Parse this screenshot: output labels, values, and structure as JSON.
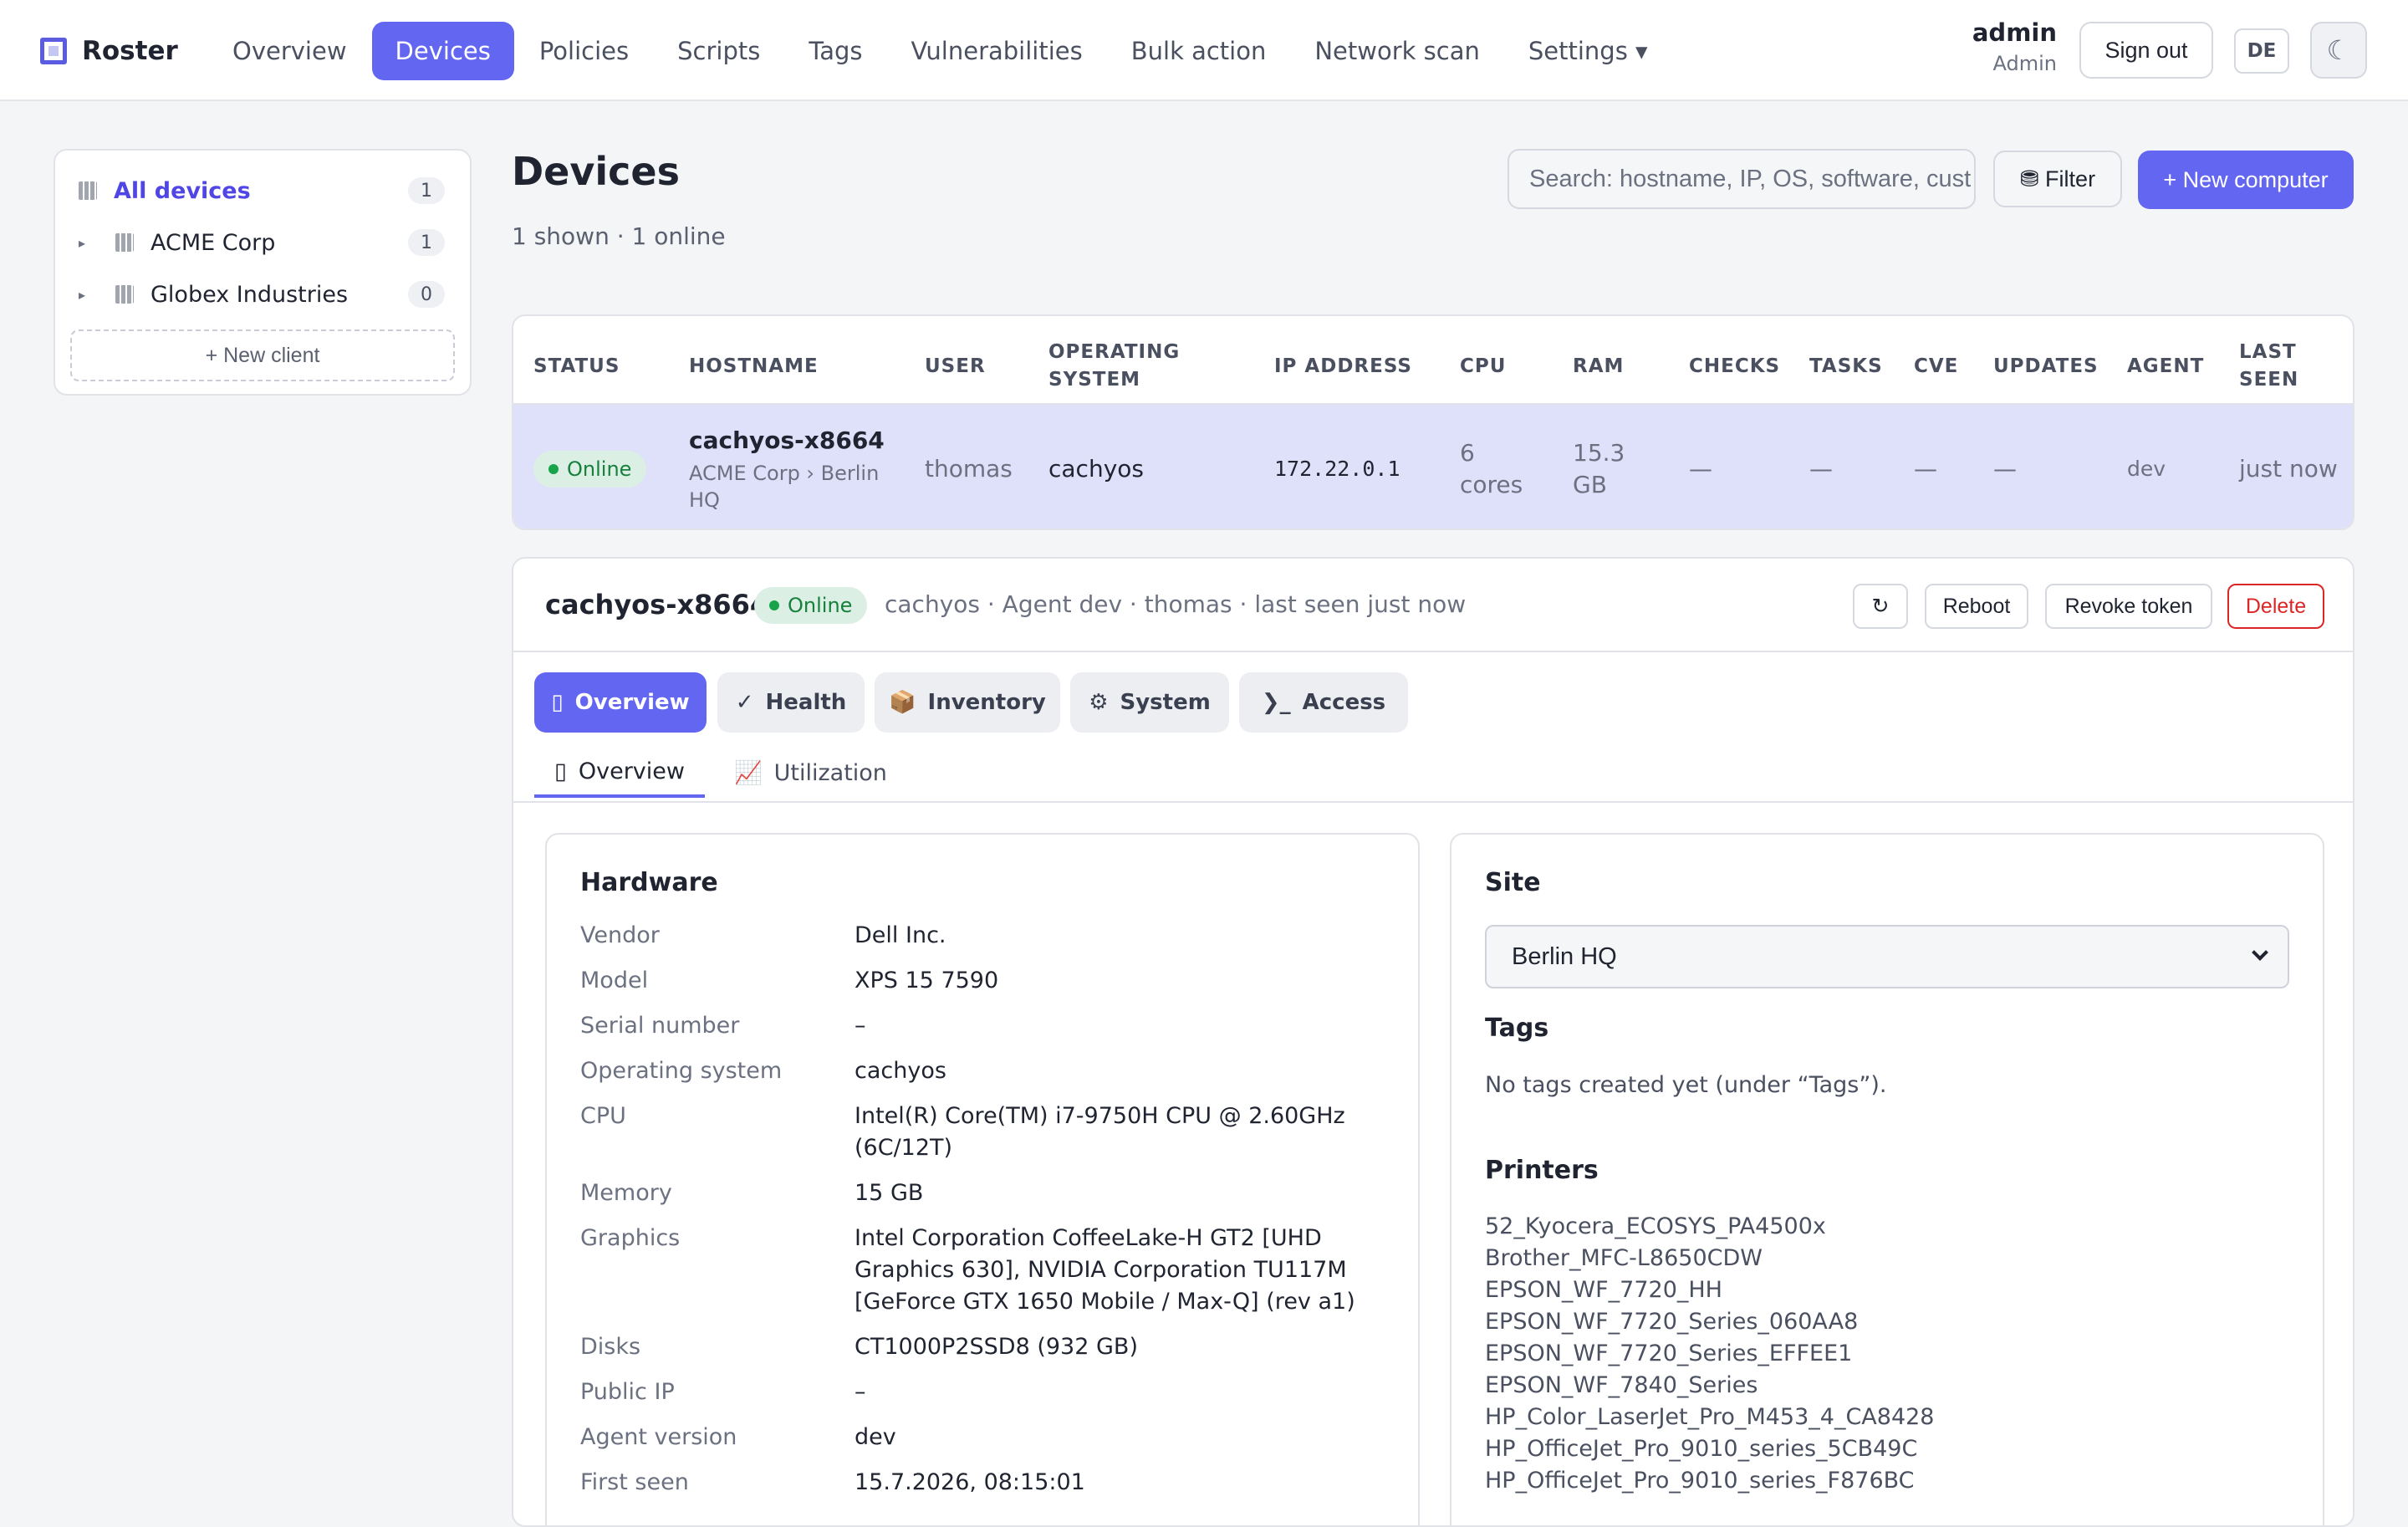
{
  "app": {
    "name": "Roster"
  },
  "nav": {
    "items": [
      {
        "label": "Overview"
      },
      {
        "label": "Devices"
      },
      {
        "label": "Policies"
      },
      {
        "label": "Scripts"
      },
      {
        "label": "Tags"
      },
      {
        "label": "Vulnerabilities"
      },
      {
        "label": "Bulk action"
      },
      {
        "label": "Network scan"
      },
      {
        "label": "Settings ▾"
      }
    ]
  },
  "user": {
    "name": "admin",
    "role": "Admin",
    "sign_out": "Sign out",
    "lang": "DE",
    "theme_icon": "☾"
  },
  "sidebar": {
    "items": [
      {
        "label": "All devices",
        "count": "1"
      },
      {
        "label": "ACME Corp",
        "count": "1"
      },
      {
        "label": "Globex Industries",
        "count": "0"
      }
    ],
    "new_client": "+ New client"
  },
  "page": {
    "title": "Devices",
    "subtitle": "1 shown · 1 online",
    "search_placeholder": "Search: hostname, IP, OS, software, cust",
    "filter_label": "⛃ Filter",
    "new_label": "+ New computer"
  },
  "table": {
    "headers": [
      "STATUS",
      "HOSTNAME",
      "USER",
      "OPERATING SYSTEM",
      "IP ADDRESS",
      "CPU",
      "RAM",
      "CHECKS",
      "TASKS",
      "CVE",
      "UPDATES",
      "AGENT",
      "LAST SEEN"
    ],
    "row": {
      "status": "Online",
      "hostname": "cachyos-x8664",
      "location": "ACME Corp › Berlin HQ",
      "user": "thomas",
      "os": "cachyos",
      "ip": "172.22.0.1",
      "cpu": "6 cores",
      "ram": "15.3 GB",
      "checks": "—",
      "tasks": "—",
      "cve": "—",
      "updates": "—",
      "agent": "dev",
      "last_seen": "just now"
    }
  },
  "detail": {
    "hostname": "cachyos-x8664",
    "status": "Online",
    "meta": "cachyos · Agent dev   · thomas   · last seen just now",
    "refresh_icon": "↻",
    "reboot": "Reboot",
    "revoke": "Revoke token",
    "delete": "Delete",
    "tabs": [
      {
        "icon": "▯",
        "label": "Overview"
      },
      {
        "icon": "✓",
        "label": "Health"
      },
      {
        "icon": "📦",
        "label": "Inventory"
      },
      {
        "icon": "⚙",
        "label": "System"
      },
      {
        "icon": "❯_",
        "label": "Access"
      }
    ],
    "subtabs": [
      {
        "icon": "▯",
        "label": "Overview"
      },
      {
        "icon": "📈",
        "label": "Utilization"
      }
    ]
  },
  "hardware": {
    "title": "Hardware",
    "rows": [
      {
        "k": "Vendor",
        "v": "Dell Inc."
      },
      {
        "k": "Model",
        "v": "XPS 15 7590"
      },
      {
        "k": "Serial number",
        "v": "–"
      },
      {
        "k": "Operating system",
        "v": "cachyos"
      },
      {
        "k": "CPU",
        "v": "Intel(R) Core(TM) i7-9750H CPU @ 2.60GHz (6C/12T)"
      },
      {
        "k": "Memory",
        "v": "15 GB"
      },
      {
        "k": "Graphics",
        "v": "Intel Corporation CoffeeLake-H GT2 [UHD Graphics 630], NVIDIA Corporation TU117M [GeForce GTX 1650 Mobile / Max-Q] (rev a1)"
      },
      {
        "k": "Disks",
        "v": "CT1000P2SSD8 (932 GB)"
      },
      {
        "k": "Public IP",
        "v": "–"
      },
      {
        "k": "Agent version",
        "v": "dev"
      },
      {
        "k": "First seen",
        "v": "15.7.2026, 08:15:01"
      }
    ]
  },
  "site": {
    "title": "Site",
    "selected": "Berlin HQ",
    "tags_title": "Tags",
    "tags_note": "No tags created yet (under “Tags”).",
    "printers_title": "Printers",
    "printers": [
      "52_Kyocera_ECOSYS_PA4500x",
      "Brother_MFC-L8650CDW",
      "EPSON_WF_7720_HH",
      "EPSON_WF_7720_Series_060AA8",
      "EPSON_WF_7720_Series_EFFEE1",
      "EPSON_WF_7840_Series",
      "HP_Color_LaserJet_Pro_M453_4_CA8428",
      "HP_OfficeJet_Pro_9010_series_5CB49C",
      "HP_OfficeJet_Pro_9010_series_F876BC"
    ]
  },
  "colors": {
    "accent": "#6366f1",
    "online": "#16a34a",
    "danger": "#dc2626",
    "selected_row": "#dfe0fa"
  }
}
